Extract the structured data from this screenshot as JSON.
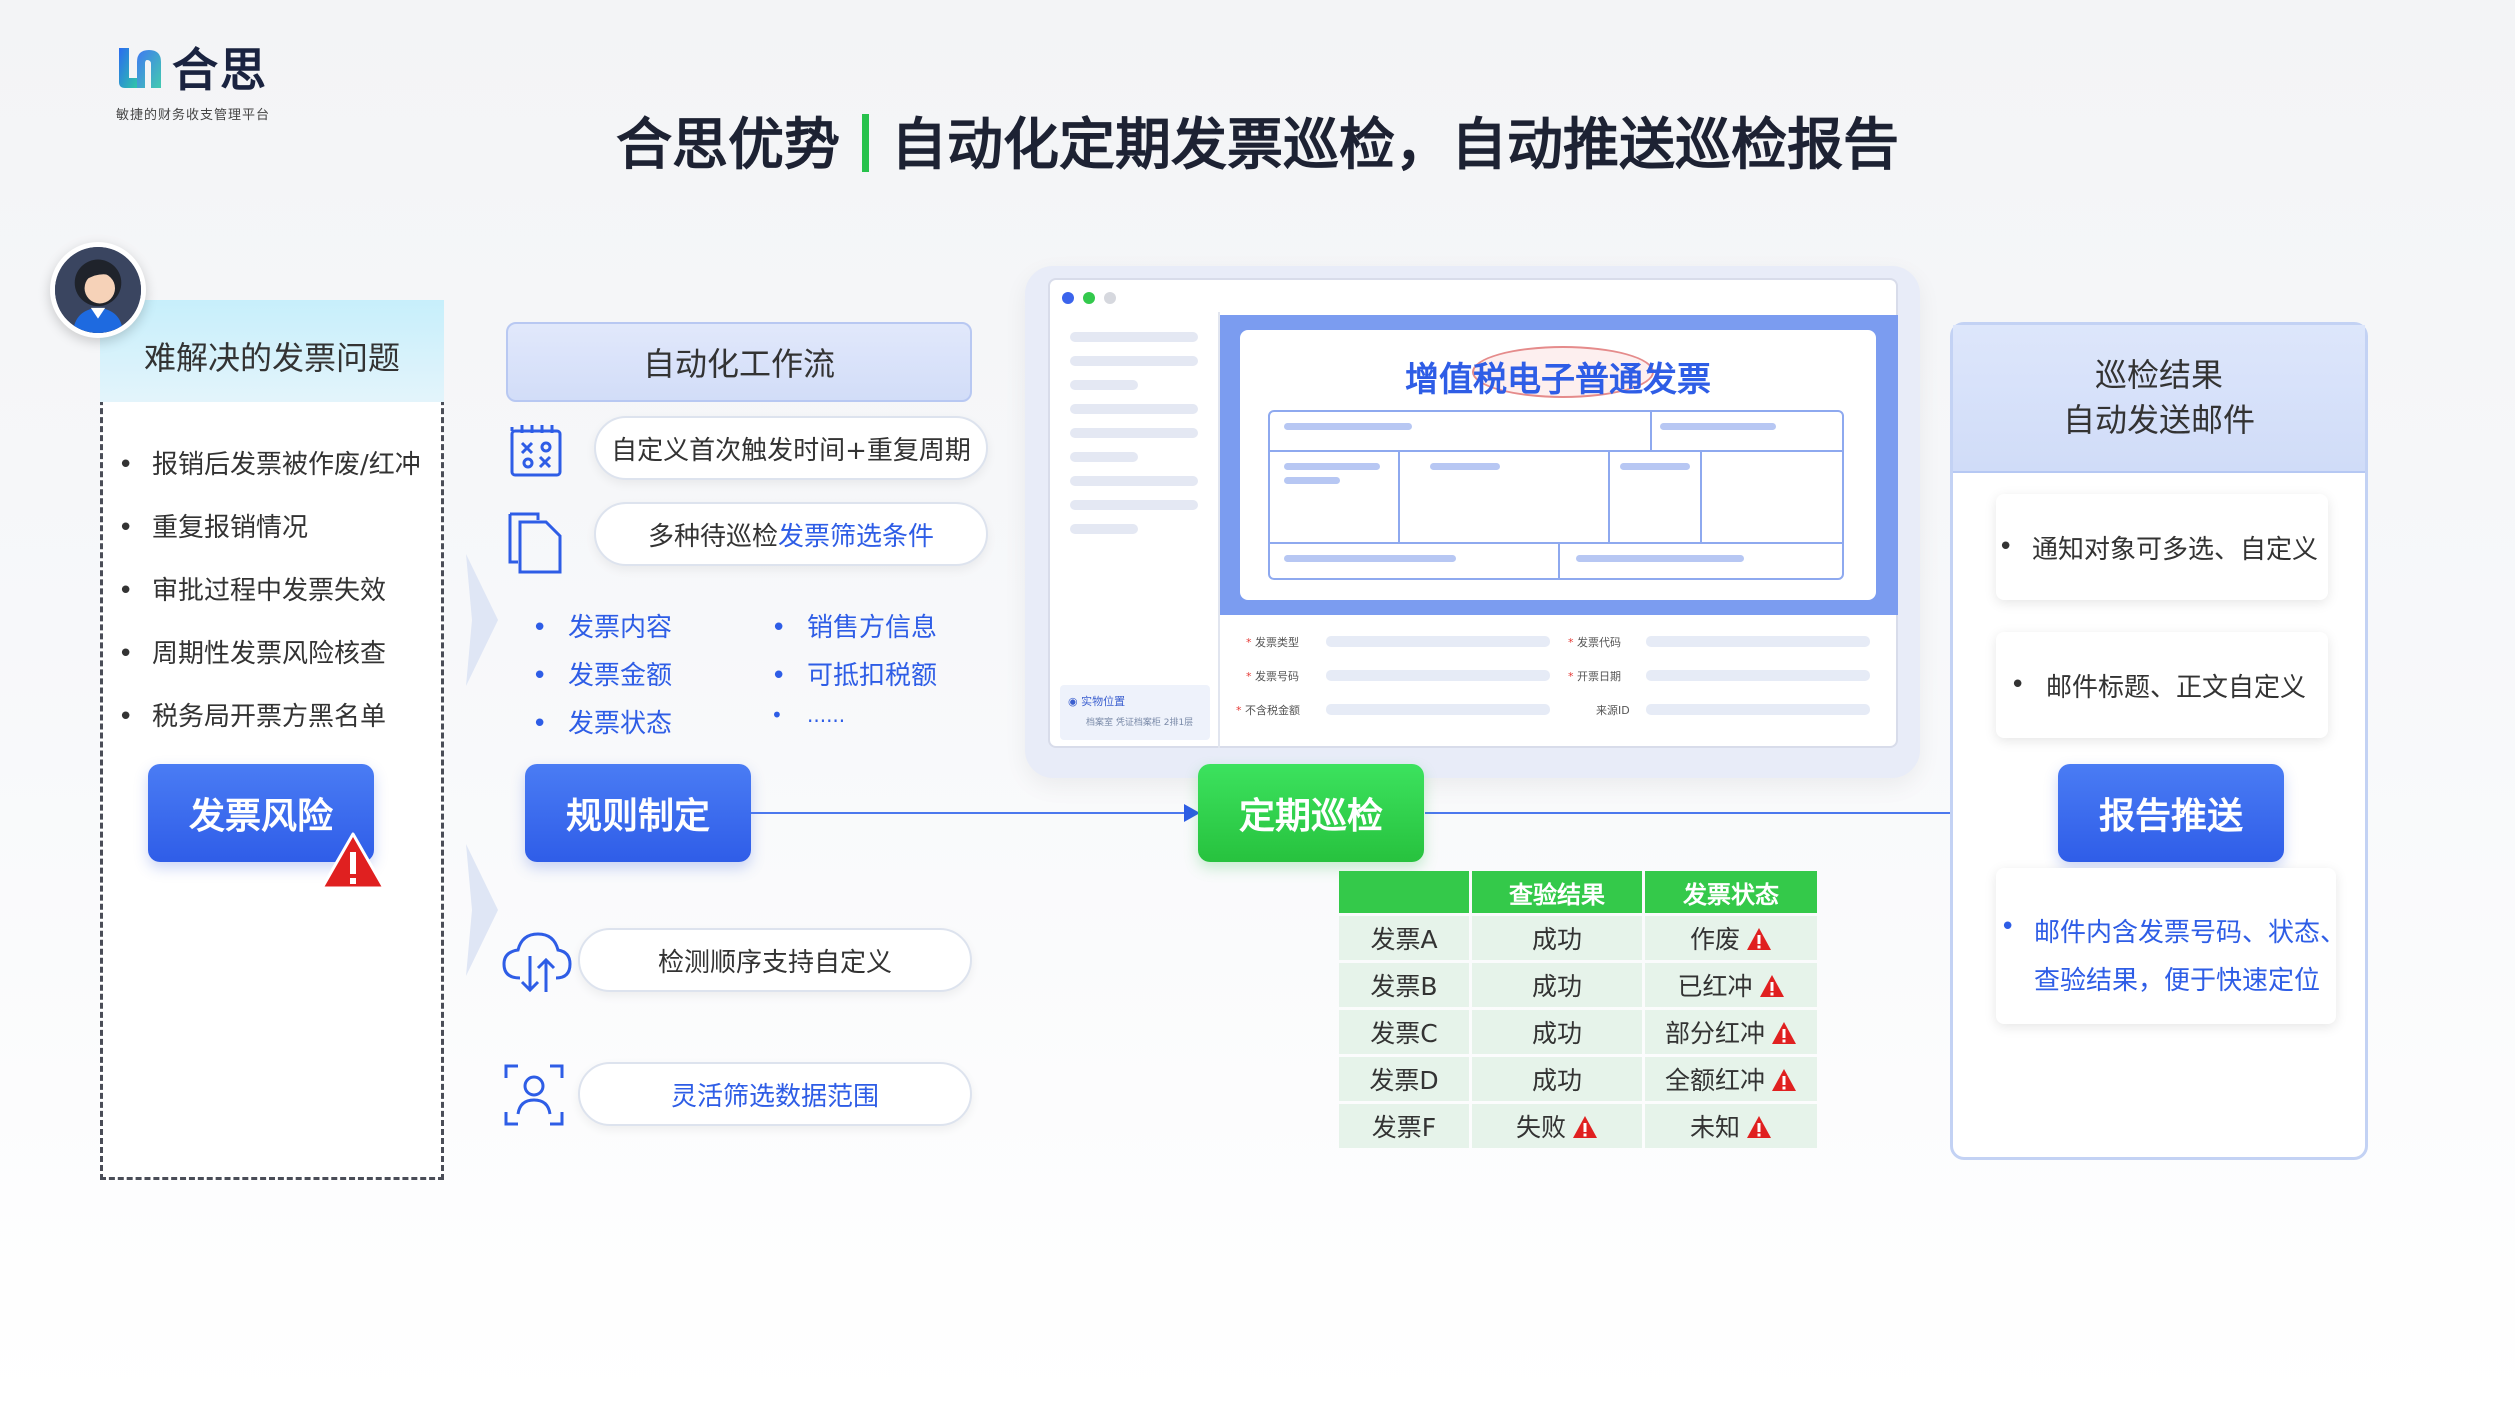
{
  "logo": {
    "name": "合思",
    "tagline": "敏捷的财务收支管理平台"
  },
  "title": {
    "left": "合思优势",
    "right": "自动化定期发票巡检，自动推送巡检报告"
  },
  "problems": {
    "header": "难解决的发票问题",
    "items": [
      "报销后发票被作废/红冲",
      "重复报销情况",
      "审批过程中发票失效",
      "周期性发票风险核查",
      "税务局开票方黑名单"
    ],
    "button": "发票风险"
  },
  "workflow": {
    "header": "自动化工作流",
    "pill1": "自定义首次触发时间+重复周期",
    "pill2_prefix": "多种待巡检",
    "pill2_highlight": "发票筛选条件",
    "conditions_left": [
      "发票内容",
      "发票金额",
      "发票状态"
    ],
    "conditions_right": [
      "销售方信息",
      "可抵扣税额",
      "......"
    ],
    "button": "规则制定",
    "pill3": "检测顺序支持自定义",
    "pill4": "灵活筛选数据范围"
  },
  "invoice": {
    "title": "增值税电子普通发票",
    "form_labels": [
      "发票类型",
      "发票代码",
      "发票号码",
      "开票日期",
      "不含税金额",
      "来源ID"
    ],
    "location_label": "实物位置",
    "location_value": "档案室 凭证档案柜 2排1层"
  },
  "inspection": {
    "button": "定期巡检",
    "table": {
      "headers": [
        "",
        "查验结果",
        "发票状态"
      ],
      "rows": [
        {
          "invoice": "发票A",
          "check": "成功",
          "status": "作废",
          "check_warn": false,
          "status_warn": true
        },
        {
          "invoice": "发票B",
          "check": "成功",
          "status": "已红冲",
          "check_warn": false,
          "status_warn": true
        },
        {
          "invoice": "发票C",
          "check": "成功",
          "status": "部分红冲",
          "check_warn": false,
          "status_warn": true
        },
        {
          "invoice": "发票D",
          "check": "成功",
          "status": "全额红冲",
          "check_warn": false,
          "status_warn": true
        },
        {
          "invoice": "发票F",
          "check": "失败",
          "status": "未知",
          "check_warn": true,
          "status_warn": true
        }
      ]
    }
  },
  "results": {
    "header_line1": "巡检结果",
    "header_line2": "自动发送邮件",
    "card1": "通知对象可多选、自定义",
    "card2": "邮件标题、正文自定义",
    "button": "报告推送",
    "card3_line1": "邮件内含发票号码、状态、",
    "card3_line2": "查验结果，便于快速定位"
  },
  "colors": {
    "brand_blue": "#2f5de8",
    "brand_green": "#27c23e",
    "warning_red": "#e02020",
    "highlight_blue": "#2e5de6"
  }
}
